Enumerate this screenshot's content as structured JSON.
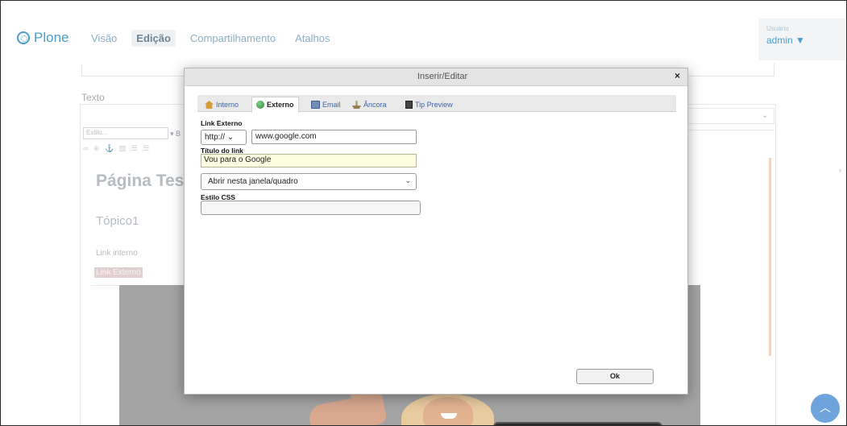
{
  "app": {
    "logo_text": "Plone",
    "nav": [
      "Visão",
      "Edição",
      "Compartilhamento",
      "Atalhos"
    ],
    "user_label": "Usuário",
    "user_name": "admin ▼"
  },
  "editor": {
    "field_label": "Texto",
    "style_placeholder": "Estilo...",
    "content": {
      "title": "Página Teste",
      "heading": "Tópico1",
      "link_internal": "Link interno",
      "link_external": "Link Externo"
    }
  },
  "dialog": {
    "title": "Inserir/Editar",
    "close": "×",
    "tabs": [
      {
        "label": "Interno",
        "icon": "house-icon"
      },
      {
        "label": "Externo",
        "icon": "globe-icon",
        "active": true
      },
      {
        "label": "Email",
        "icon": "email-icon"
      },
      {
        "label": "Âncora",
        "icon": "anchor-icon"
      },
      {
        "label": "Tip Preview",
        "icon": "preview-icon"
      }
    ],
    "external_link_label": "Link Externo",
    "protocol": "http://",
    "url_value": "www.google.com",
    "link_title_label": "Título do link",
    "link_title_value": "Vou para o Google",
    "target_value": "Abrir nesta janela/quadro",
    "css_label": "Estilo CSS",
    "css_value": "",
    "ok_label": "Ok"
  }
}
